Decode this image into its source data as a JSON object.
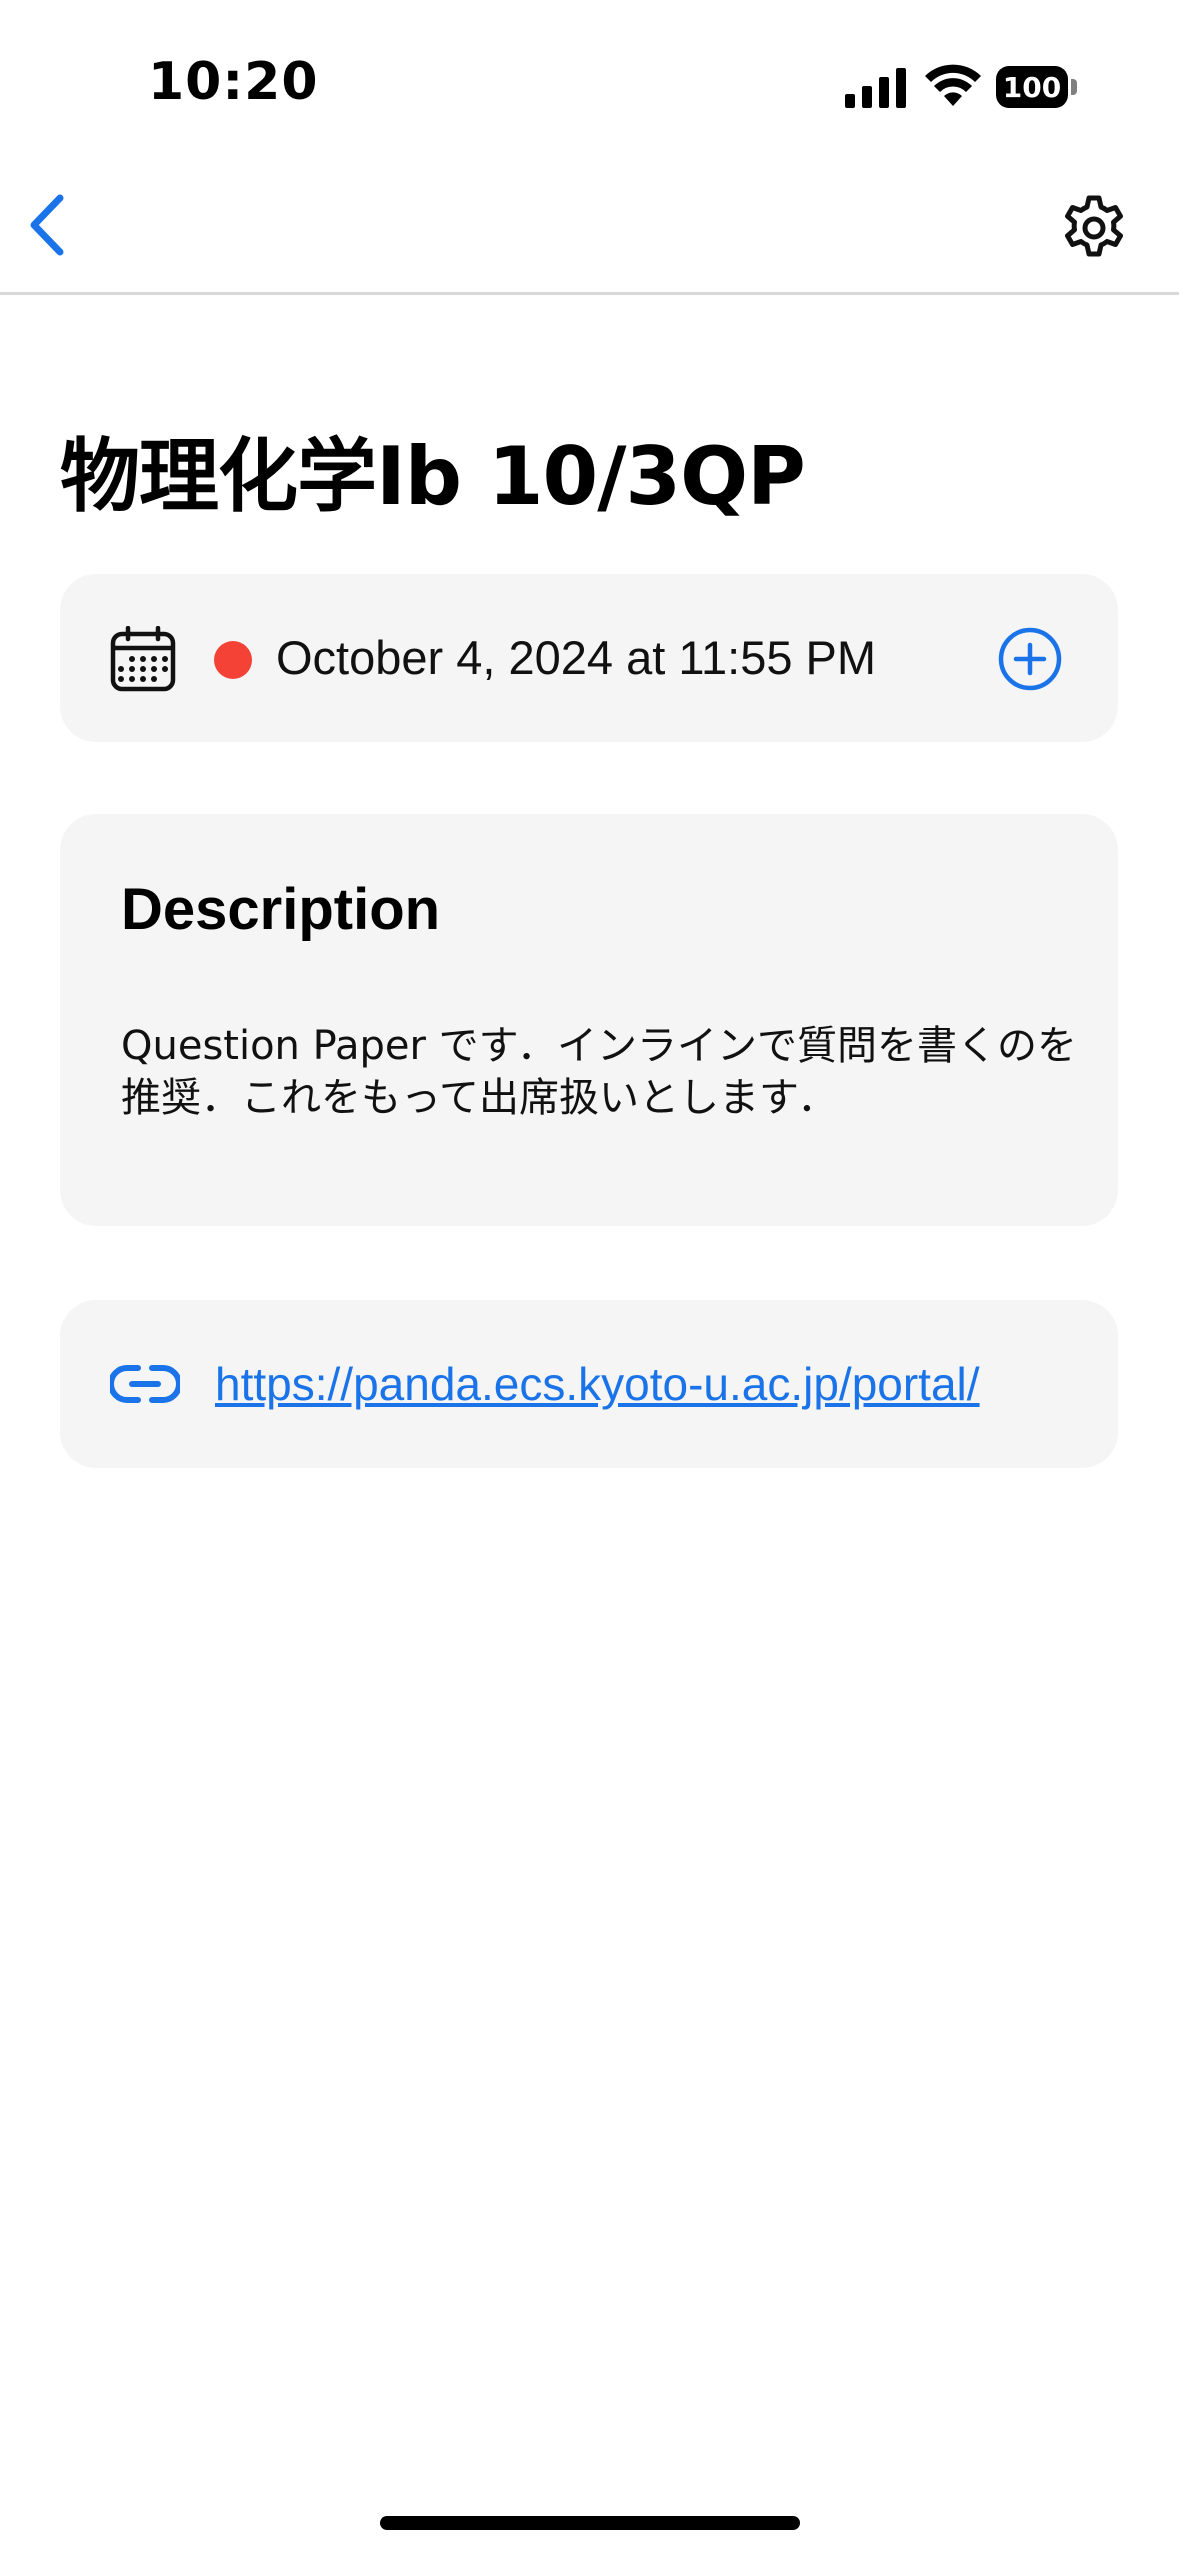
{
  "status_bar": {
    "time": "10:20",
    "battery_level": "100",
    "icons": [
      "signal-icon",
      "wifi-icon",
      "battery-icon"
    ]
  },
  "nav": {
    "back_icon": "chevron-left-icon",
    "settings_icon": "gear-icon"
  },
  "page": {
    "title": "物理化学Ib 10/3QP"
  },
  "due": {
    "icon": "calendar-icon",
    "status_color": "#f44336",
    "date_text": "October 4, 2024 at 11:55 PM",
    "add_icon": "plus-circle-icon"
  },
  "description": {
    "heading": "Description",
    "body": "Question Paper です．インラインで質問を書くのを推奨．これをもって出席扱いとします．"
  },
  "link": {
    "icon": "link-icon",
    "url_text": "https://panda.ecs.kyoto-u.ac.jp/portal/"
  },
  "colors": {
    "accent": "#1a73e8",
    "card_bg": "#f5f5f5",
    "status_red": "#f44336"
  }
}
